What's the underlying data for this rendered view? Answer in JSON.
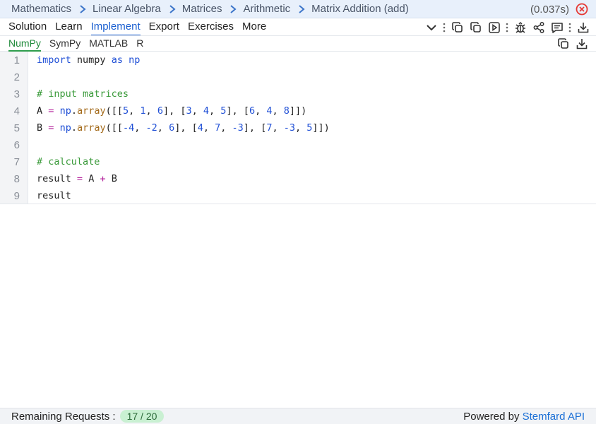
{
  "breadcrumb": {
    "items": [
      "Mathematics",
      "Linear Algebra",
      "Matrices",
      "Arithmetic",
      "Matrix Addition (add)"
    ]
  },
  "timing": "(0.037s)",
  "tabs": {
    "items": [
      "Solution",
      "Learn",
      "Implement",
      "Export",
      "Exercises",
      "More"
    ],
    "active": "Implement"
  },
  "languages": {
    "items": [
      "NumPy",
      "SymPy",
      "MATLAB",
      "R"
    ],
    "active": "NumPy"
  },
  "code": {
    "line_numbers": [
      "1",
      "2",
      "3",
      "4",
      "5",
      "6",
      "7",
      "8",
      "9"
    ],
    "line1": {
      "kw": "import",
      "t1": " numpy ",
      "kw2": "as",
      "t2": " ",
      "mod": "np"
    },
    "line3": {
      "comment": "# input matrices"
    },
    "line4": {
      "var": "A",
      "eq": "=",
      "mod": "np",
      "dot": ".",
      "fn": "array",
      "open": "([[",
      "v": [
        "5",
        "1",
        "6",
        "3",
        "4",
        "5",
        "6",
        "4",
        "8"
      ]
    },
    "line5": {
      "var": "B",
      "eq": "=",
      "mod": "np",
      "dot": ".",
      "fn": "array",
      "open": "([[",
      "v": [
        "-4",
        "-2",
        "6",
        "4",
        "7",
        "-3",
        "7",
        "-3",
        "5"
      ]
    },
    "line7": {
      "comment": "# calculate"
    },
    "line8": {
      "var": "result",
      "eq": "=",
      "a": "A",
      "plus": "+",
      "b": "B"
    },
    "line9": {
      "var": "result"
    }
  },
  "footer": {
    "remaining_label": "Remaining Requests :",
    "remaining_value": "17 / 20",
    "powered_by": "Powered by",
    "brand": "Stemfard API"
  },
  "icons": {
    "close": "close-circle-icon",
    "toolbar": [
      "chevron-down-icon",
      "vertical-dots-icon",
      "copy-icon",
      "copy-icon",
      "play-icon",
      "vertical-dots-icon",
      "bug-icon",
      "share-icon",
      "comment-icon",
      "vertical-dots-icon",
      "download-icon"
    ],
    "language_tools": [
      "copy-icon",
      "download-icon"
    ]
  },
  "colors": {
    "accent": "#1a5fd0",
    "active_language": "#1f8a3a",
    "breadcrumb_bg": "#e8f0fb",
    "close_red": "#e53935",
    "badge_bg": "#c9f0d2"
  }
}
